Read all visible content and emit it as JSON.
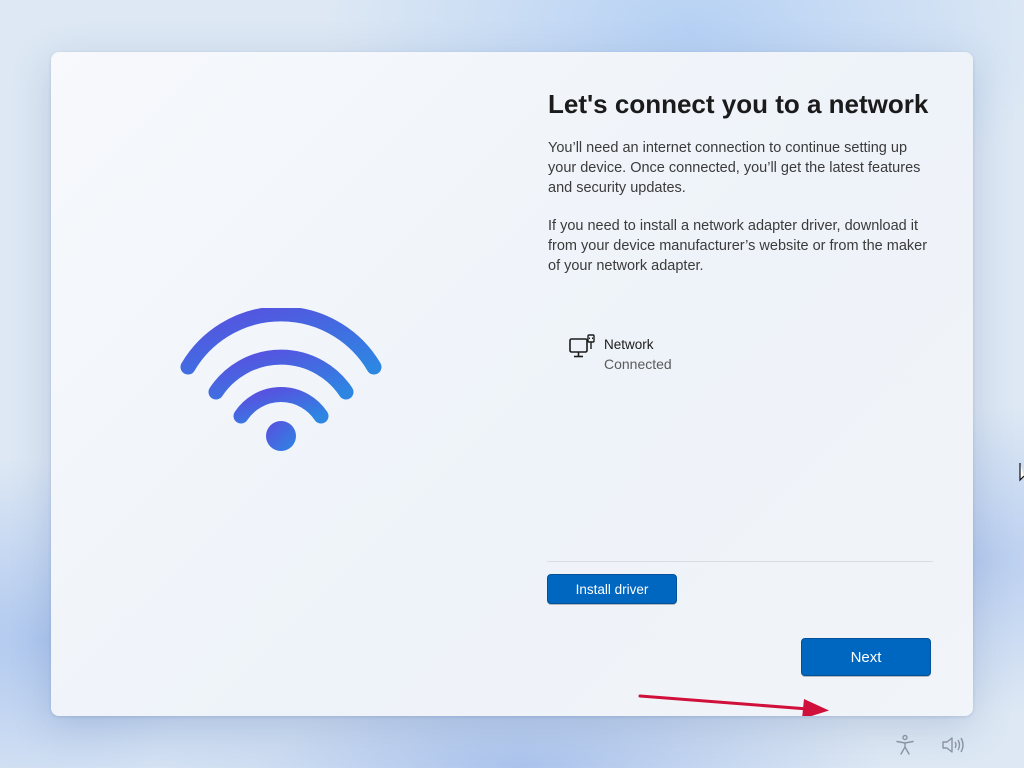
{
  "setup": {
    "title": "Let's connect you to a network",
    "paragraph1": "You’ll need an internet connection to continue setting up your device. Once connected, you’ll get the latest features and security updates.",
    "paragraph2": "If you need to install a network adapter driver, download it from your device manufacturer’s website or from the maker of your network adapter.",
    "network": {
      "name": "Network",
      "status": "Connected",
      "icon": "ethernet-computer-icon"
    },
    "buttons": {
      "install_driver": "Install driver",
      "next": "Next"
    }
  },
  "illustration": {
    "icon": "wifi-icon"
  },
  "annotation": {
    "icon": "red-arrow",
    "color": "#d0103a"
  },
  "taskbar": {
    "icons": [
      "accessibility-icon",
      "volume-icon"
    ]
  },
  "colors": {
    "accent": "#0067c0",
    "wifi_gradient_start": "#5b4fe0",
    "wifi_gradient_end": "#2f7fe0"
  }
}
